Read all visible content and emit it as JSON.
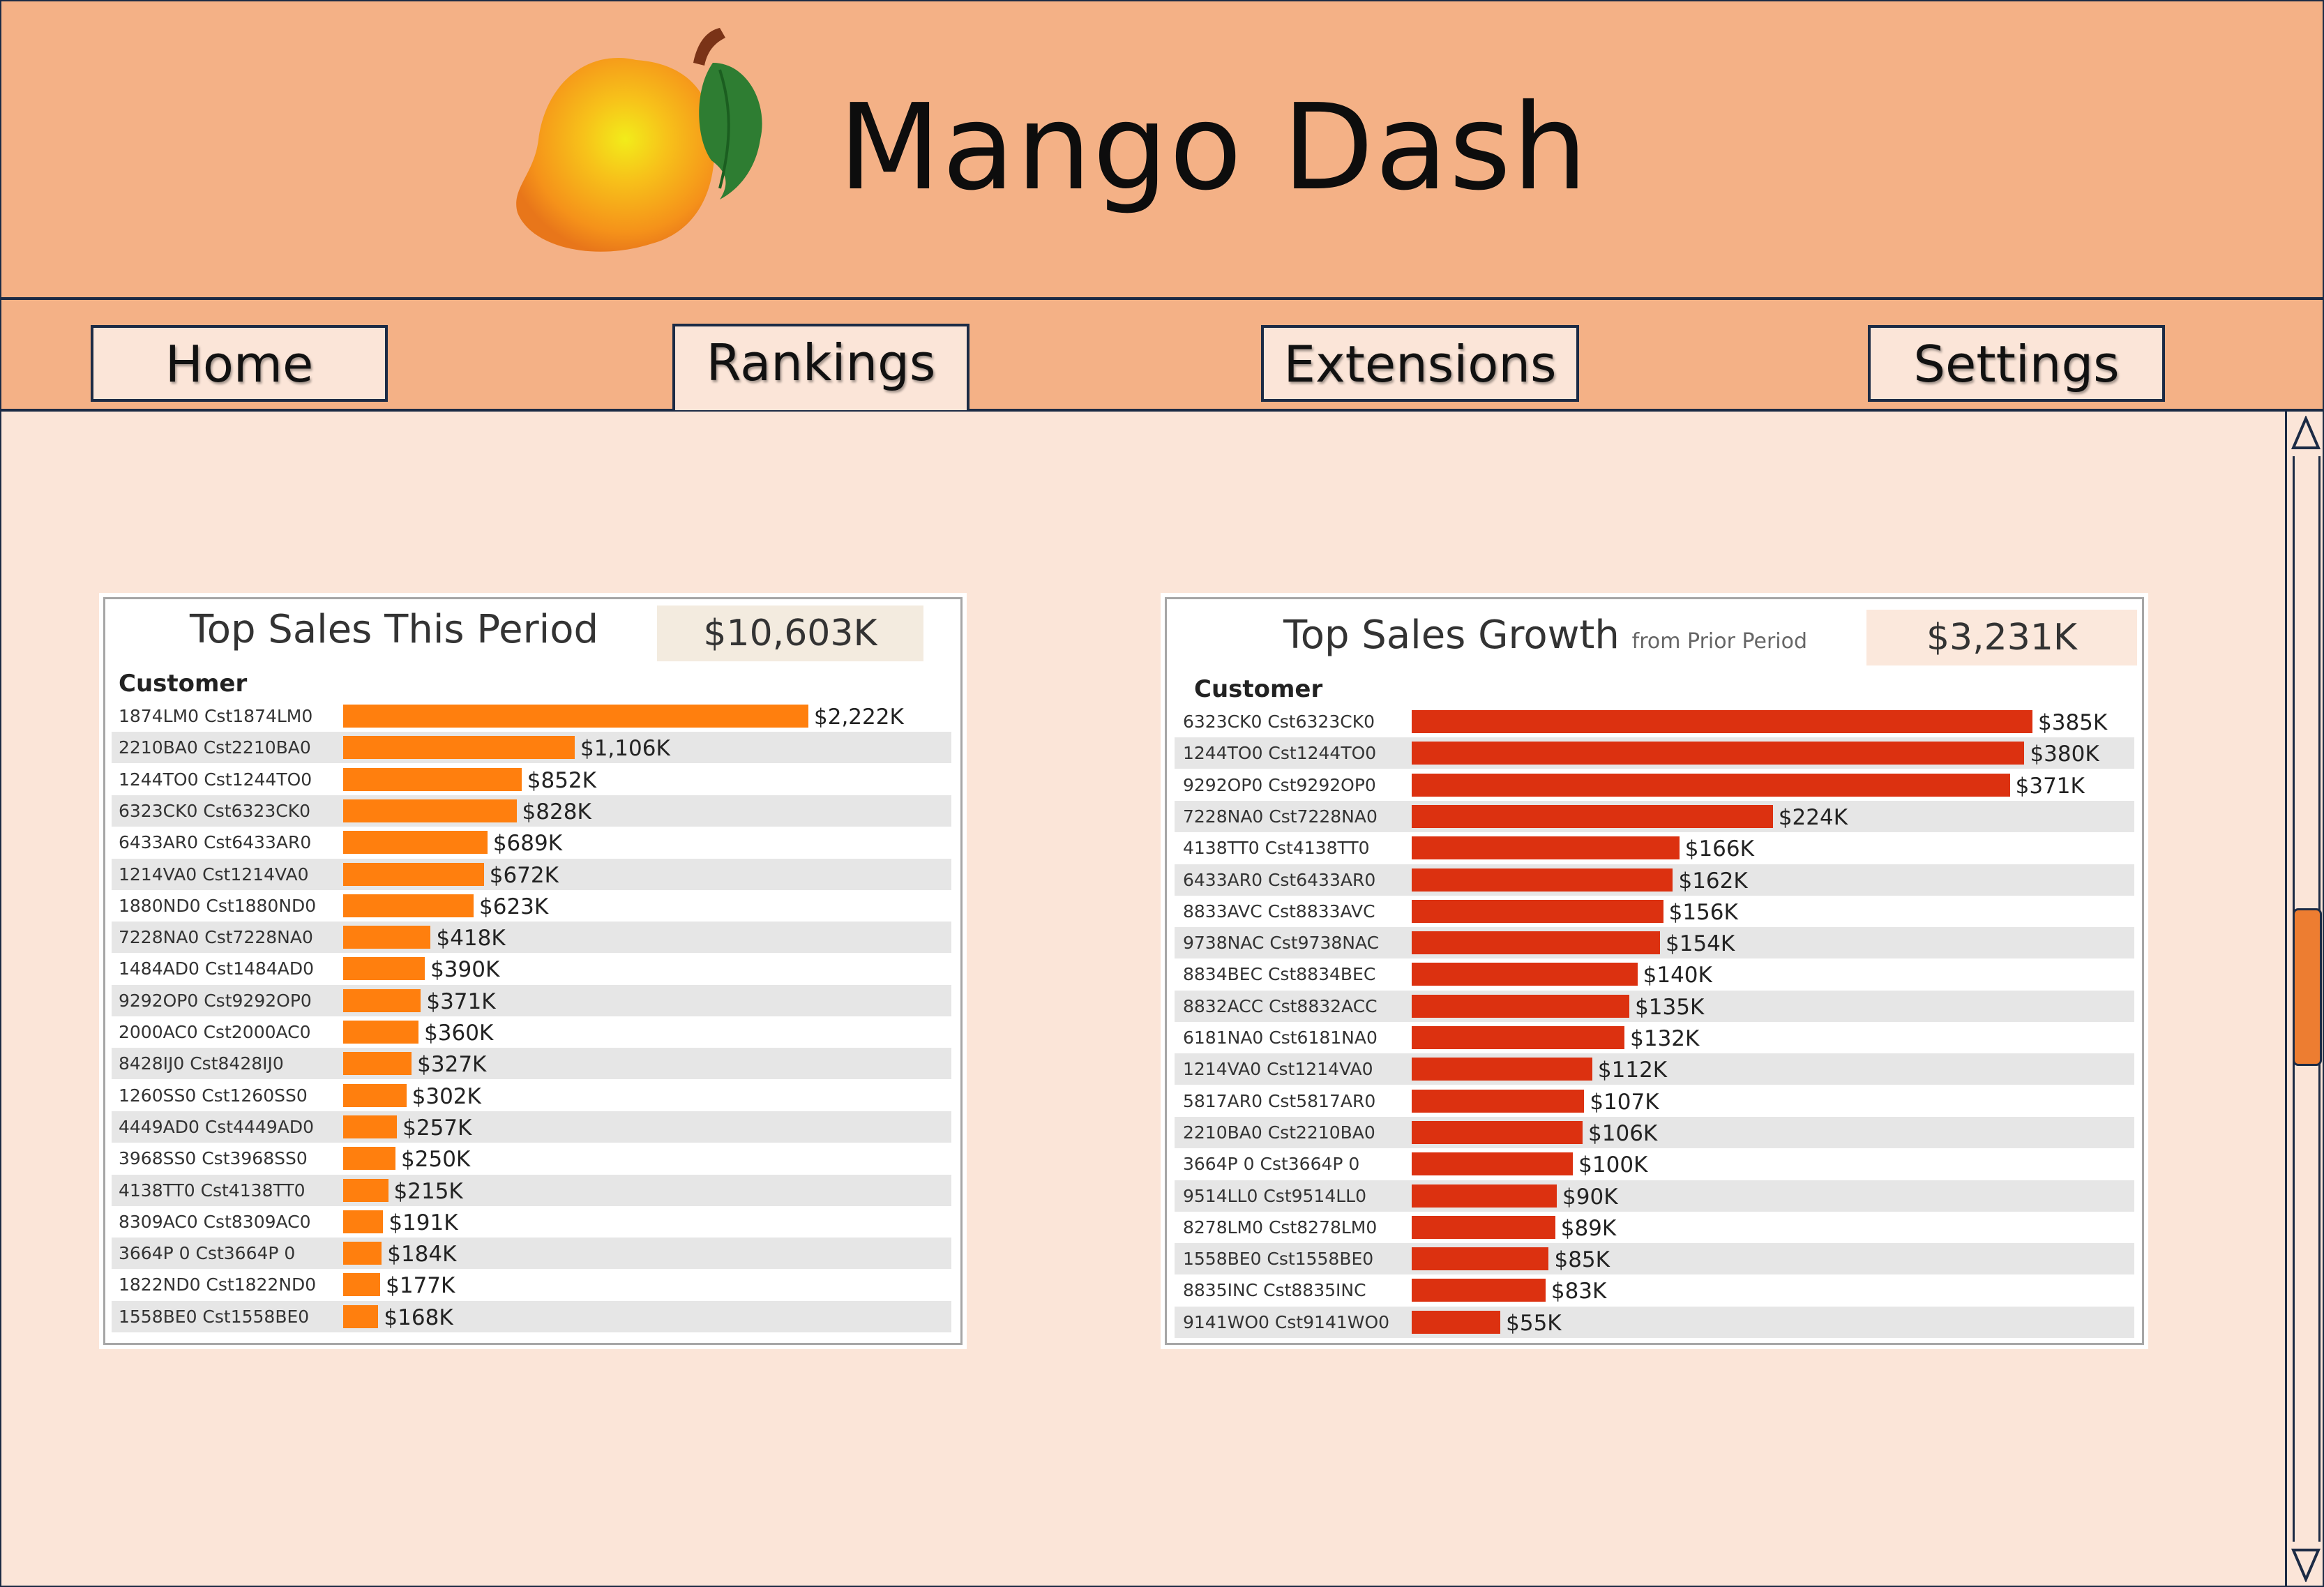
{
  "app": {
    "title": "Mango Dash"
  },
  "nav": {
    "tabs": [
      {
        "label": "Home"
      },
      {
        "label": "Rankings",
        "active": true
      },
      {
        "label": "Extensions"
      },
      {
        "label": "Settings"
      }
    ]
  },
  "colors": {
    "header_bg": "#f4b186",
    "content_bg": "#fbe5d8",
    "border": "#1c2b45",
    "sales_bar": "#ff7f0e",
    "growth_bar": "#dc3110",
    "scroll_thumb": "#ed7d31"
  },
  "chart_data": [
    {
      "type": "bar",
      "orientation": "horizontal",
      "title": "Top Sales This Period",
      "subtitle": "",
      "total": "$10,603K",
      "column_header": "Customer",
      "xlim": [
        0,
        2222
      ],
      "categories": [
        "1874LM0  Cst1874LM0",
        "2210BA0  Cst2210BA0",
        "1244TO0  Cst1244TO0",
        "6323CK0  Cst6323CK0",
        "6433AR0  Cst6433AR0",
        "1214VA0  Cst1214VA0",
        "1880ND0  Cst1880ND0",
        "7228NA0  Cst7228NA0",
        "1484AD0  Cst1484AD0",
        "9292OP0  Cst9292OP0",
        "2000AC0  Cst2000AC0",
        "8428IJ0  Cst8428IJ0",
        "1260SS0  Cst1260SS0",
        "4449AD0  Cst4449AD0",
        "3968SS0  Cst3968SS0",
        "4138TT0  Cst4138TT0",
        "8309AC0  Cst8309AC0",
        "3664P 0  Cst3664P 0",
        "1822ND0  Cst1822ND0",
        "1558BE0  Cst1558BE0"
      ],
      "values": [
        2222,
        1106,
        852,
        828,
        689,
        672,
        623,
        418,
        390,
        371,
        360,
        327,
        302,
        257,
        250,
        215,
        191,
        184,
        177,
        168
      ],
      "labels": [
        "$2,222K",
        "$1,106K",
        "$852K",
        "$828K",
        "$689K",
        "$672K",
        "$623K",
        "$418K",
        "$390K",
        "$371K",
        "$360K",
        "$327K",
        "$302K",
        "$257K",
        "$250K",
        "$215K",
        "$191K",
        "$184K",
        "$177K",
        "$168K"
      ]
    },
    {
      "type": "bar",
      "orientation": "horizontal",
      "title": "Top Sales Growth",
      "subtitle": "from Prior Period",
      "total": "$3,231K",
      "column_header": "Customer",
      "xlim": [
        0,
        385
      ],
      "categories": [
        "6323CK0  Cst6323CK0",
        "1244TO0  Cst1244TO0",
        "9292OP0  Cst9292OP0",
        "7228NA0  Cst7228NA0",
        "4138TT0  Cst4138TT0",
        "6433AR0  Cst6433AR0",
        "8833AVC  Cst8833AVC",
        "9738NAC  Cst9738NAC",
        "8834BEC  Cst8834BEC",
        "8832ACC  Cst8832ACC",
        "6181NA0  Cst6181NA0",
        "1214VA0  Cst1214VA0",
        "5817AR0  Cst5817AR0",
        "2210BA0  Cst2210BA0",
        "3664P 0  Cst3664P 0",
        "9514LL0  Cst9514LL0",
        "8278LM0  Cst8278LM0",
        "1558BE0  Cst1558BE0",
        "8835INC  Cst8835INC",
        "9141WO0  Cst9141WO0"
      ],
      "values": [
        385,
        380,
        371,
        224,
        166,
        162,
        156,
        154,
        140,
        135,
        132,
        112,
        107,
        106,
        100,
        90,
        89,
        85,
        83,
        55
      ],
      "labels": [
        "$385K",
        "$380K",
        "$371K",
        "$224K",
        "$166K",
        "$162K",
        "$156K",
        "$154K",
        "$140K",
        "$135K",
        "$132K",
        "$112K",
        "$107K",
        "$106K",
        "$100K",
        "$90K",
        "$89K",
        "$85K",
        "$83K",
        "$55K"
      ]
    }
  ]
}
